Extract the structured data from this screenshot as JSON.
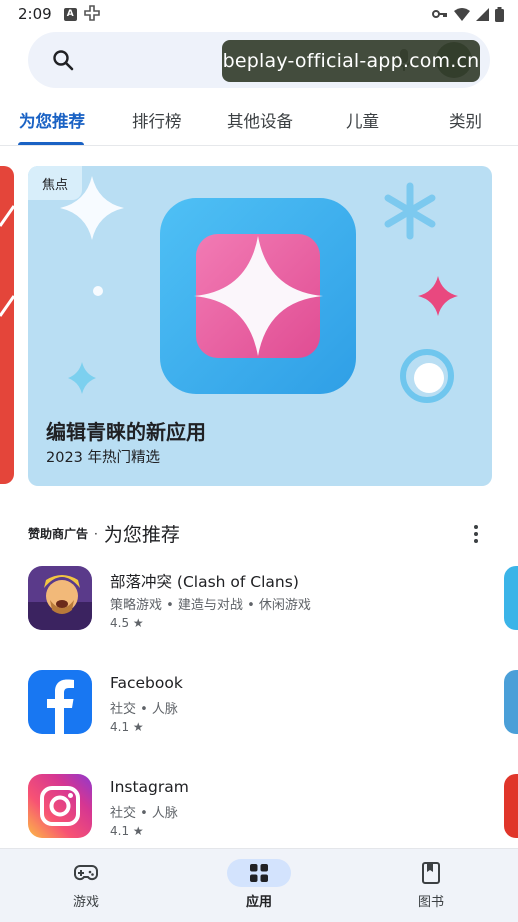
{
  "status_bar": {
    "time": "2:09",
    "left_icons": [
      "a-icon",
      "game-controller-icon"
    ],
    "right_icons": [
      "vpn-key-icon",
      "wifi-icon",
      "signal-icon",
      "battery-icon"
    ]
  },
  "search": {
    "placeholder": "",
    "watermark": "beplay-official-app.com.cn"
  },
  "tabs": [
    {
      "label": "为您推荐",
      "active": true
    },
    {
      "label": "排行榜",
      "active": false
    },
    {
      "label": "其他设备",
      "active": false
    },
    {
      "label": "儿童",
      "active": false
    },
    {
      "label": "类别",
      "active": false
    }
  ],
  "banner": {
    "badge": "焦点",
    "headline": "编辑青睐的新应用",
    "subtitle": "2023 年热门精选"
  },
  "section": {
    "ad_label": "赞助商广告",
    "separator": "·",
    "title": "为您推荐"
  },
  "apps": [
    {
      "name": "部落冲突 (Clash of Clans)",
      "category": "策略游戏 • 建造与对战 • 休闲游戏",
      "rating": "4.5 ★"
    },
    {
      "name": "Facebook",
      "category": "社交 • 人脉",
      "rating": "4.1 ★"
    },
    {
      "name": "Instagram",
      "category": "社交 • 人脉",
      "rating": "4.1 ★"
    }
  ],
  "bottom_nav": [
    {
      "label": "游戏",
      "icon": "gamepad-icon",
      "active": false
    },
    {
      "label": "应用",
      "icon": "apps-grid-icon",
      "active": true
    },
    {
      "label": "图书",
      "icon": "book-icon",
      "active": false
    }
  ],
  "colors": {
    "accent": "#1a62c4",
    "banner_bg": "#b9def3",
    "nav_bg": "#f0f3f9",
    "nav_active": "#d3e3fd"
  }
}
